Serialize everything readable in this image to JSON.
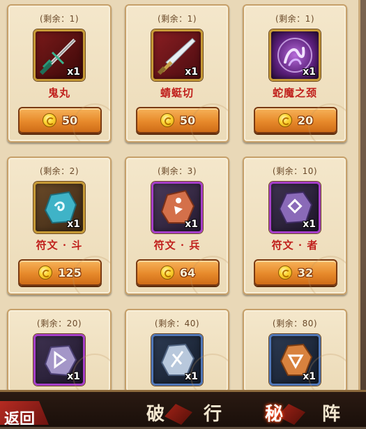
{
  "items": [
    {
      "remain": "(剩余：1)",
      "name": "鬼丸",
      "qty": "x1",
      "price": "50",
      "icon": "sword-icon",
      "frame": "gold"
    },
    {
      "remain": "(剩余：1)",
      "name": "蜻蜓切",
      "qty": "x1",
      "price": "50",
      "icon": "blade-icon",
      "frame": "gold"
    },
    {
      "remain": "(剩余：1)",
      "name": "蛇魔之颈",
      "qty": "x1",
      "price": "20",
      "icon": "serpent-orb-icon",
      "frame": "gold"
    },
    {
      "remain": "(剩余：2)",
      "name": "符文 · 斗",
      "qty": "x1",
      "price": "125",
      "icon": "rune-stone-teal-icon",
      "frame": "gold"
    },
    {
      "remain": "(剩余：3)",
      "name": "符文 · 兵",
      "qty": "x1",
      "price": "64",
      "icon": "rune-stone-orange-icon",
      "frame": "purple"
    },
    {
      "remain": "(剩余：10)",
      "name": "符文 · 者",
      "qty": "x1",
      "price": "32",
      "icon": "rune-stone-purple-icon",
      "frame": "purple"
    },
    {
      "remain": "(剩余：20)",
      "name": "",
      "qty": "x1",
      "price": "",
      "icon": "rune-stone-lavender-icon",
      "frame": "purple"
    },
    {
      "remain": "(剩余：40)",
      "name": "",
      "qty": "x1",
      "price": "",
      "icon": "rune-stone-silver-icon",
      "frame": "blue"
    },
    {
      "remain": "(剩余：80)",
      "name": "",
      "qty": "x1",
      "price": "",
      "icon": "rune-stone-amber-icon",
      "frame": "blue"
    }
  ],
  "tabs": {
    "back_label": "返回",
    "tab1": "破",
    "tab2": "行",
    "tab3": "秘",
    "tab4": "阵"
  },
  "colors": {
    "accent": "#c0201c",
    "button": "#e78a2b",
    "panel": "#ecdbb8"
  }
}
